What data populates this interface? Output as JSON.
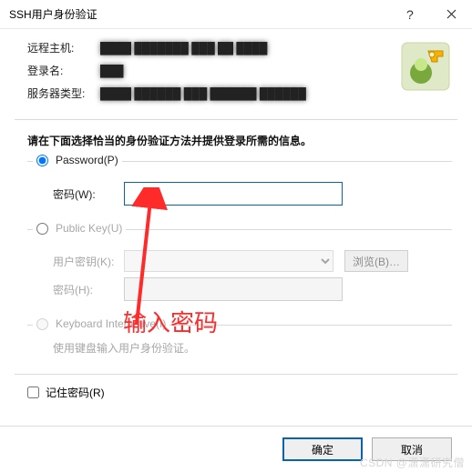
{
  "titlebar": {
    "title": "SSH用户身份验证"
  },
  "info": {
    "remote_host_label": "远程主机:",
    "remote_host_value": "████ ███████ ███ ██ ████",
    "login_label": "登录名:",
    "login_value": "███",
    "server_type_label": "服务器类型:",
    "server_type_value": "████ ██████ ███ ██████ ██████"
  },
  "instruction": "请在下面选择恰当的身份验证方法并提供登录所需的信息。",
  "password_group": {
    "radio_label": "Password(P)",
    "field_label": "密码(W):",
    "value": ""
  },
  "pubkey_group": {
    "radio_label": "Public Key(U)",
    "userkey_label": "用户密钥(K):",
    "browse_label": "浏览(B)…",
    "passphrase_label": "密码(H):"
  },
  "kbd_group": {
    "radio_label": "Keyboard Interactive(I)",
    "hint": "使用键盘输入用户身份验证。"
  },
  "remember": {
    "label": "记住密码(R)"
  },
  "buttons": {
    "ok": "确定",
    "cancel": "取消"
  },
  "annotation": "输入密码",
  "watermark": "CSDN @潇潇研究僧"
}
